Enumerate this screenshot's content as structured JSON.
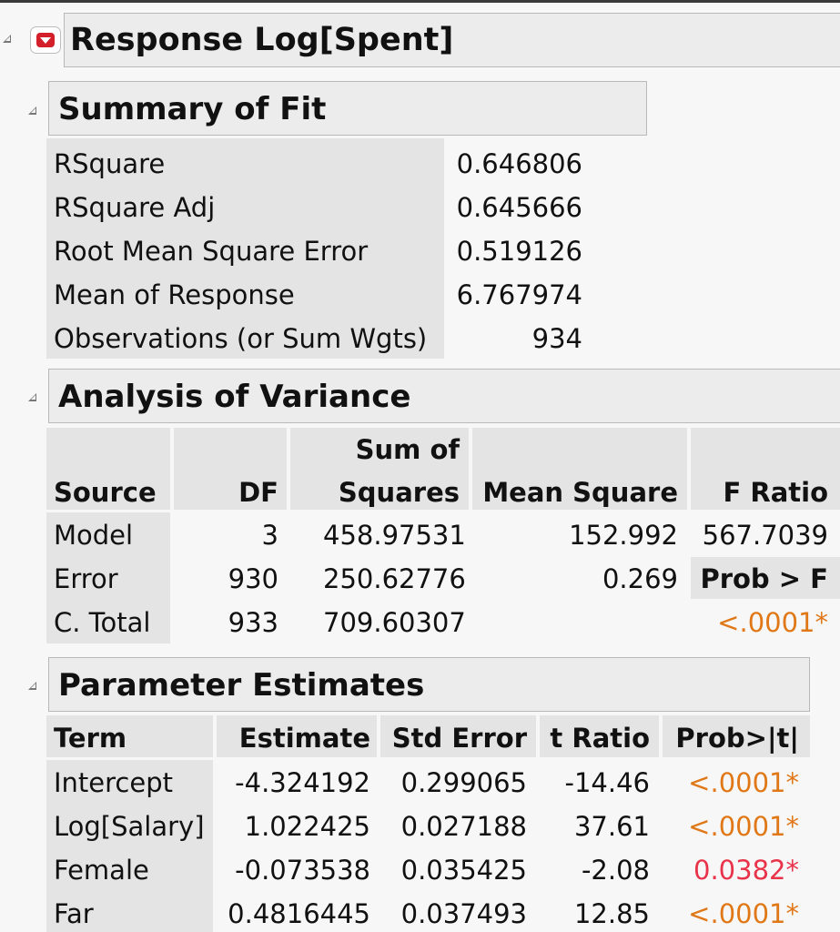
{
  "report": {
    "title": "Response Log[Spent]"
  },
  "summary_of_fit": {
    "title": "Summary of Fit",
    "rows": [
      {
        "label": "RSquare",
        "value": "0.646806"
      },
      {
        "label": "RSquare Adj",
        "value": "0.645666"
      },
      {
        "label": "Root Mean Square Error",
        "value": "0.519126"
      },
      {
        "label": "Mean of Response",
        "value": "6.767974"
      },
      {
        "label": "Observations (or Sum Wgts)",
        "value": "934"
      }
    ]
  },
  "anova": {
    "title": "Analysis of Variance",
    "headers": {
      "source": "Source",
      "df": "DF",
      "ss_line1": "Sum of",
      "ss_line2": "Squares",
      "ms": "Mean Square",
      "f": "F Ratio"
    },
    "rows": [
      {
        "source": "Model",
        "df": "3",
        "ss": "458.97531",
        "ms": "152.992",
        "f": "567.7039"
      },
      {
        "source": "Error",
        "df": "930",
        "ss": "250.62776",
        "ms": "0.269",
        "f": "Prob > F"
      },
      {
        "source": "C. Total",
        "df": "933",
        "ss": "709.60307",
        "ms": "",
        "f": "<.0001*"
      }
    ]
  },
  "parameter_estimates": {
    "title": "Parameter Estimates",
    "headers": {
      "term": "Term",
      "estimate": "Estimate",
      "stderr": "Std Error",
      "tratio": "t Ratio",
      "prob": "Prob>|t|"
    },
    "rows": [
      {
        "term": "Intercept",
        "estimate": "-4.324192",
        "stderr": "0.299065",
        "tratio": "-14.46",
        "prob": "<.0001*"
      },
      {
        "term": "Log[Salary]",
        "estimate": "1.022425",
        "stderr": "0.027188",
        "tratio": "37.61",
        "prob": "<.0001*"
      },
      {
        "term": "Female",
        "estimate": "-0.073538",
        "stderr": "0.035425",
        "tratio": "-2.08",
        "prob": "0.0382*"
      },
      {
        "term": "Far",
        "estimate": "0.4816445",
        "stderr": "0.037493",
        "tratio": "12.85",
        "prob": "<.0001*"
      }
    ]
  },
  "colors": {
    "significant_strong": "#e07818",
    "significant_weak": "#e8334a",
    "header_bg": "#ececec",
    "label_bg": "#e4e4e4"
  }
}
